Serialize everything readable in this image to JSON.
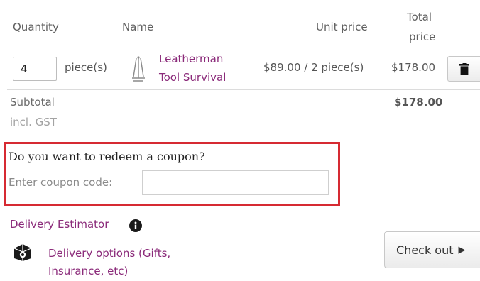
{
  "table": {
    "headers": {
      "quantity": "Quantity",
      "name": "Name",
      "unit_price": "Unit price",
      "total_line1": "Total",
      "total_line2": "price"
    },
    "row": {
      "quantity_value": "4",
      "unit_label": "piece(s)",
      "product_name_line1": "Leatherman",
      "product_name_line2": "Tool Survival",
      "unit_price": "$89.00 / 2 piece(s)",
      "total": "$178.00",
      "delete_icon": "trash-icon"
    }
  },
  "summary": {
    "subtotal_label": "Subtotal",
    "tax_note": "incl. GST",
    "subtotal_value": "$178.00"
  },
  "coupon": {
    "question": "Do you want to redeem a coupon?",
    "label": "Enter coupon code:",
    "value": "",
    "highlight_color": "#d62a32"
  },
  "delivery": {
    "estimator_label": "Delivery Estimator",
    "info_icon": "info-icon",
    "options_line1": "Delivery options (Gifts,",
    "options_line2": "Insurance, etc)",
    "options_icon": "gift-box-icon"
  },
  "checkout": {
    "label": "Check out",
    "arrow": "▶"
  },
  "colors": {
    "link": "#8b2b7a",
    "highlight": "#d62a32"
  }
}
